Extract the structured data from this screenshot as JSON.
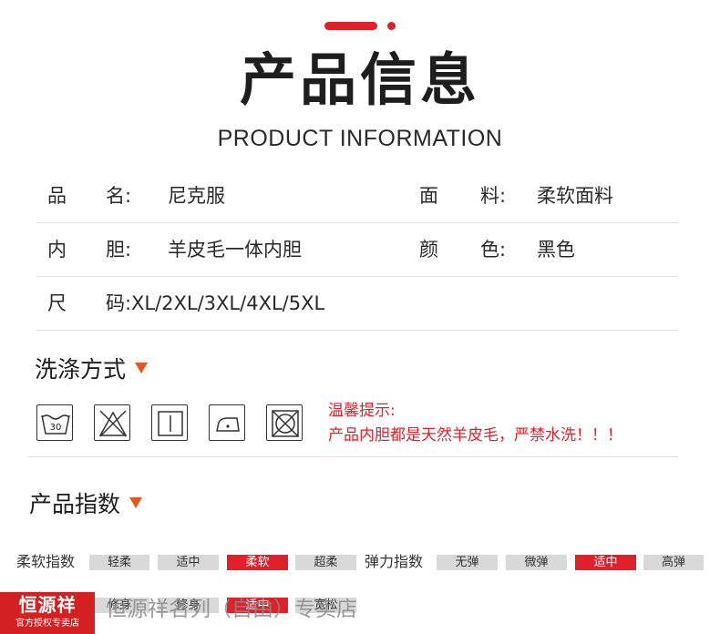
{
  "header": {
    "title_cn": "产品信息",
    "title_en": "PRODUCT INFORMATION"
  },
  "info": {
    "name_label_a": "品",
    "name_label_b": "名:",
    "name_value": "尼克服",
    "fabric_label_a": "面",
    "fabric_label_b": "料:",
    "fabric_value": "柔软面料",
    "lining_label_a": "内",
    "lining_label_b": "胆:",
    "lining_value": "羊皮毛一体内胆",
    "color_label_a": "颜",
    "color_label_b": "色:",
    "color_value": "黑色",
    "size_label_a": "尺",
    "size_label_b": "码:",
    "size_value": "XL/2XL/3XL/4XL/5XL"
  },
  "washing": {
    "title": "洗涤方式",
    "icons": [
      "wash-30-icon",
      "no-bleach-icon",
      "line-dry-icon",
      "iron-icon",
      "no-tumble-dry-icon"
    ],
    "icon_30_text": "30",
    "warning_line1": "温馨提示:",
    "warning_line2": "产品内胆都是天然羊皮毛，严禁水洗！！！"
  },
  "index": {
    "title": "产品指数",
    "softness_label": "柔软指数",
    "softness_options": [
      "轻柔",
      "适中",
      "柔软",
      "超柔"
    ],
    "softness_selected": "柔软",
    "elasticity_label": "弹力指数",
    "elasticity_options": [
      "无弹",
      "微弹",
      "适中",
      "高弹"
    ],
    "elasticity_selected": "适中",
    "fit_options": [
      "修身",
      "修身",
      "适中",
      "宽松"
    ],
    "fit_selected": "适中"
  },
  "footer": {
    "logo_text": "恒源祥",
    "logo_sub": "官方授权专卖店",
    "store_name": "恒源祥名列（自由）专卖店"
  },
  "colors": {
    "accent_red": "#e0202a",
    "triangle_orange": "#e8541e"
  }
}
